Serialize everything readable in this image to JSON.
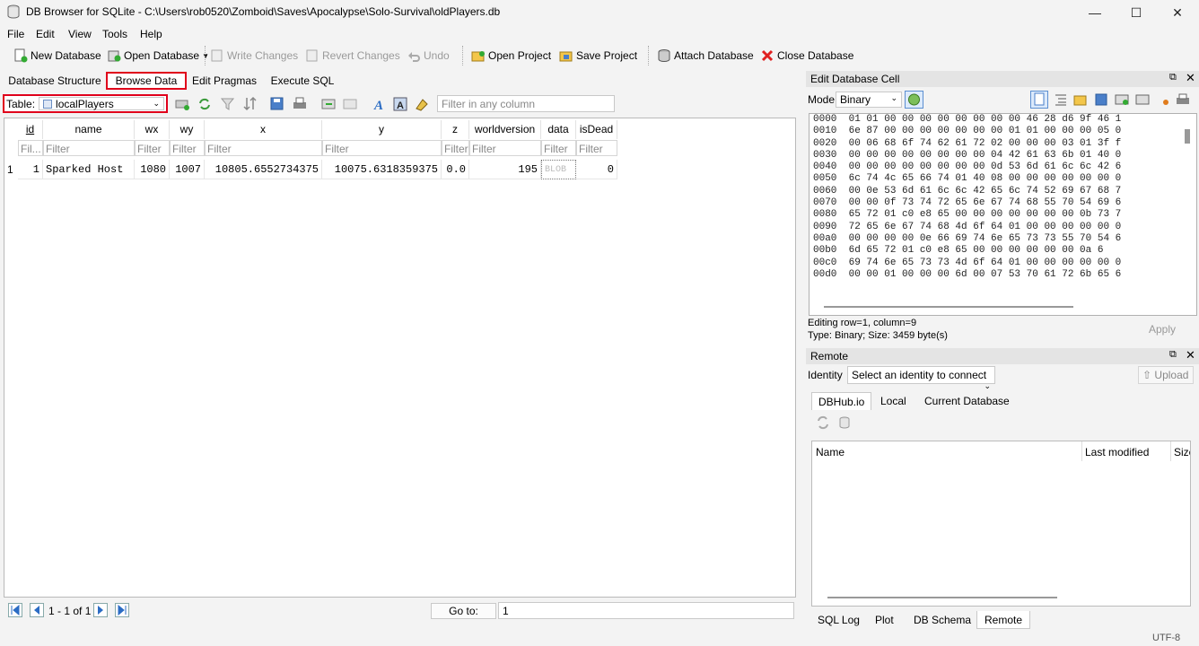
{
  "window": {
    "title": "DB Browser for SQLite - C:\\Users\\rob0520\\Zomboid\\Saves\\Apocalypse\\Solo-Survival\\oldPlayers.db"
  },
  "menu": [
    "File",
    "Edit",
    "View",
    "Tools",
    "Help"
  ],
  "toolbar": {
    "new_db": "New Database",
    "open_db": "Open Database",
    "write": "Write Changes",
    "revert": "Revert Changes",
    "undo": "Undo",
    "open_proj": "Open Project",
    "save_proj": "Save Project",
    "attach": "Attach Database",
    "close": "Close Database"
  },
  "tabs": [
    "Database Structure",
    "Browse Data",
    "Edit Pragmas",
    "Execute SQL"
  ],
  "browse": {
    "table_label": "Table:",
    "table_name": "localPlayers",
    "filter_placeholder": "Filter in any column"
  },
  "grid": {
    "columns": [
      "id",
      "name",
      "wx",
      "wy",
      "x",
      "y",
      "z",
      "worldversion",
      "data",
      "isDead"
    ],
    "filter_placeholders": [
      "Fil...",
      "Filter",
      "Filter",
      "Filter",
      "Filter",
      "Filter",
      "Filter",
      "Filter",
      "Filter",
      "Filter"
    ],
    "row_number": "1",
    "row": [
      "1",
      "Sparked Host",
      "1080",
      "1007",
      "10805.6552734375",
      "10075.6318359375",
      "0.0",
      "195",
      "BLOB",
      "0"
    ]
  },
  "pager": {
    "range": "1 - 1 of 1",
    "goto_label": "Go to:",
    "goto_value": "1"
  },
  "edit_cell": {
    "title": "Edit Database Cell",
    "mode_label": "Mode:",
    "mode": "Binary",
    "apply": "Apply",
    "status1": "Editing row=1, column=9",
    "status2": "Type: Binary; Size: 3459 byte(s)",
    "hex": [
      "0000  01 01 00 00 00 00 00 00 00 00 46 28 d6 9f 46 1",
      "0010  6e 87 00 00 00 00 00 00 00 01 01 00 00 00 05 0",
      "0020  00 06 68 6f 74 62 61 72 02 00 00 00 03 01 3f f",
      "0030  00 00 00 00 00 00 00 00 04 42 61 63 6b 01 40 0",
      "0040  00 00 00 00 00 00 00 00 0d 53 6d 61 6c 6c 42 6",
      "0050  6c 74 4c 65 66 74 01 40 08 00 00 00 00 00 00 0",
      "0060  00 0e 53 6d 61 6c 6c 42 65 6c 74 52 69 67 68 7",
      "0070  00 00 0f 73 74 72 65 6e 67 74 68 55 70 54 69 6",
      "0080  65 72 01 c0 e8 65 00 00 00 00 00 00 00 0b 73 7",
      "0090  72 65 6e 67 74 68 4d 6f 64 01 00 00 00 00 00 0",
      "00a0  00 00 00 00 0e 66 69 74 6e 65 73 73 55 70 54 6",
      "00b0  6d 65 72 01 c0 e8 65 00 00 00 00 00 00 0a 6",
      "00c0  69 74 6e 65 73 73 4d 6f 64 01 00 00 00 00 00 0",
      "00d0  00 00 01 00 00 00 6d 00 07 53 70 61 72 6b 65 6"
    ]
  },
  "remote": {
    "title": "Remote",
    "identity_label": "Identity",
    "identity_value": "Select an identity to connect",
    "upload": "Upload",
    "tabs": [
      "DBHub.io",
      "Local",
      "Current Database"
    ],
    "columns": [
      "Name",
      "Last modified",
      "Size"
    ]
  },
  "bottom_tabs": [
    "SQL Log",
    "Plot",
    "DB Schema",
    "Remote"
  ],
  "status": {
    "encoding": "UTF-8"
  },
  "colors": {
    "highlight": "#e0001b",
    "accent": "#2b6cc4"
  }
}
